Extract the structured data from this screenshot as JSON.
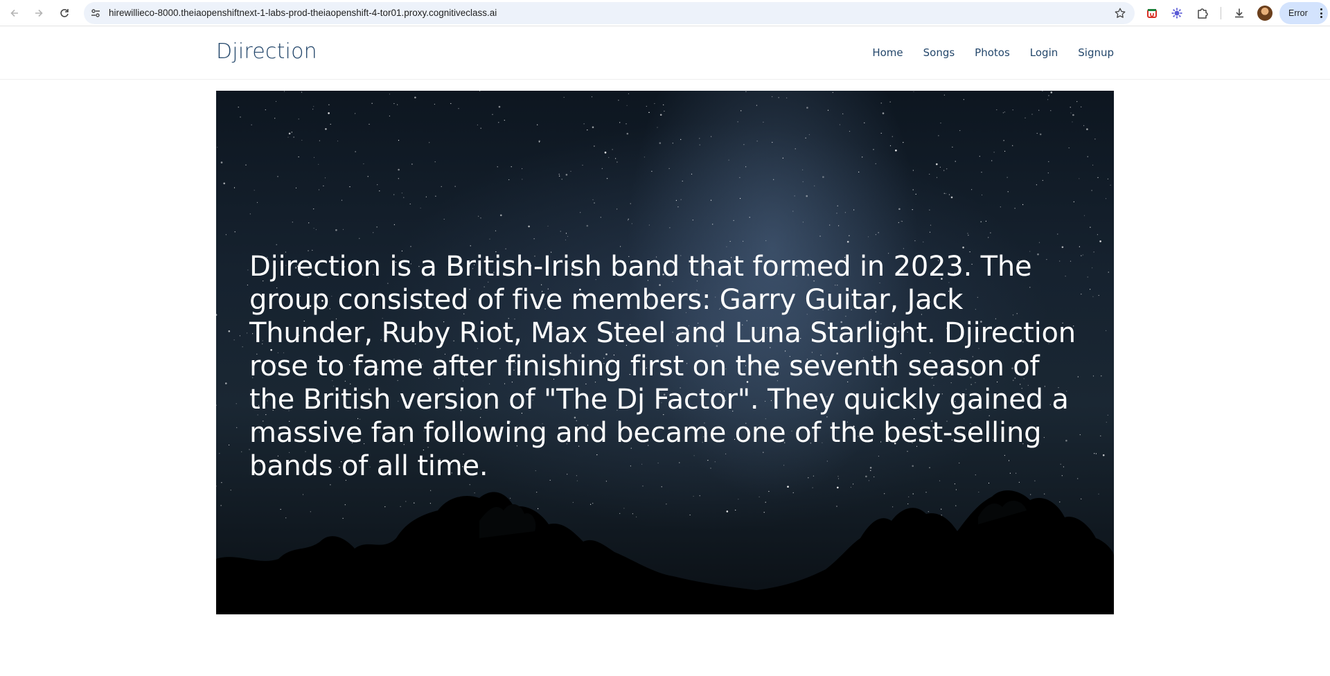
{
  "browser": {
    "url": "hirewillieco-8000.theiaopenshiftnext-1-labs-prod-theiaopenshift-4-tor01.proxy.cognitiveclass.ai",
    "status_label": "Error",
    "icons": [
      "back-icon",
      "forward-icon",
      "reload-icon",
      "site-info-icon",
      "bookmark-star-icon",
      "extension-1-icon",
      "extension-2-icon",
      "extensions-puzzle-icon",
      "download-icon",
      "profile-avatar",
      "menu-dots-icon"
    ]
  },
  "site": {
    "brand": "Djirection",
    "nav": [
      "Home",
      "Songs",
      "Photos",
      "Login",
      "Signup"
    ],
    "hero_text": "Djirection is a British-Irish band that formed in 2023. The group consisted of five members: Garry Guitar, Jack Thunder, Ruby Riot, Max Steel and Luna Starlight. Djirection rose to fame after finishing first on the seventh season of the British version of \"The Dj Factor\". They quickly gained a massive fan following and became one of the best-selling bands of all time."
  },
  "colors": {
    "brand": "#24476b",
    "omnibox_bg": "#edf2fa",
    "error_chip_bg": "#d3e3fd",
    "hero_text": "#ffffff"
  }
}
